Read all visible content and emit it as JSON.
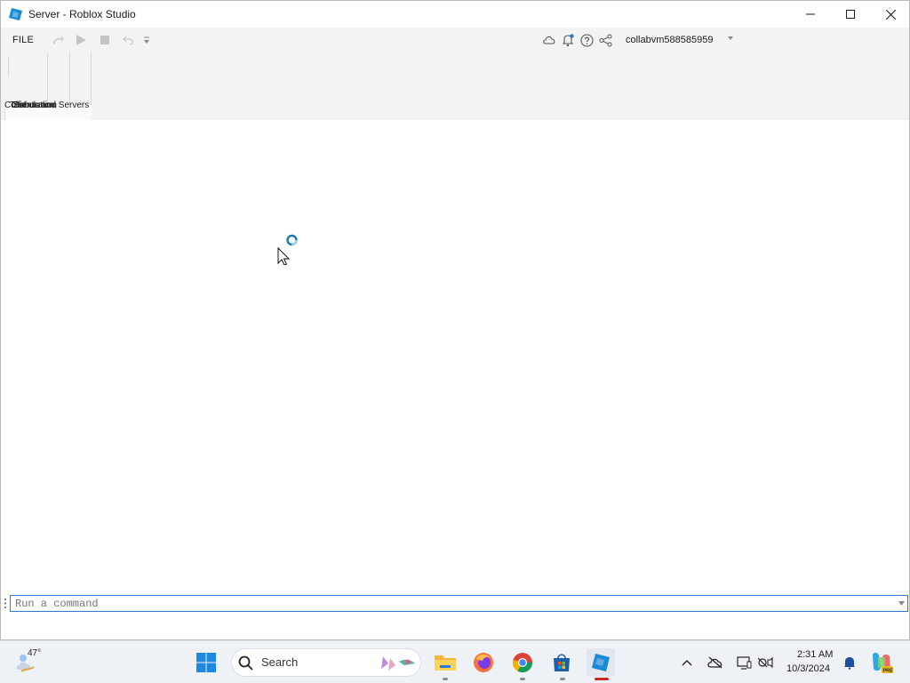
{
  "window": {
    "title": "Server - Roblox Studio",
    "controls": [
      "minimize",
      "maximize",
      "close"
    ]
  },
  "ribbon": {
    "file_menu": "FILE",
    "quick_access": [
      "redo-icon",
      "play-icon",
      "stop-icon",
      "undo-icon",
      "customize-icon"
    ],
    "header_icons": [
      "cloud-icon",
      "notification-bell-icon",
      "help-icon",
      "share-icon"
    ],
    "user": "collabvm588585959",
    "tab_labels_overlapping": [
      "Collaboration",
      "Test",
      "Simulation",
      "Clients and Servers"
    ],
    "tab_label_visible": "Clients and Servers"
  },
  "command_bar": {
    "placeholder": "Run a command",
    "value": ""
  },
  "taskbar": {
    "weather_temp": "47°",
    "search_label": "Search",
    "apps": [
      "windows-start-icon",
      "file-explorer-icon",
      "firefox-icon",
      "chrome-icon",
      "microsoft-store-icon",
      "roblox-studio-icon"
    ],
    "tray": [
      "chevron-up-icon",
      "onedrive-offline-icon",
      "display-icon",
      "network-sound-icon"
    ],
    "time": "2:31 AM",
    "date": "10/3/2024"
  },
  "colors": {
    "accent": "#2b7bd6",
    "ribbon_bg": "#f3f3f3",
    "taskbar_bg": "#eef1f6",
    "roblox_blue": "#1a8ad4",
    "running_indicator": "#c42b1c"
  }
}
